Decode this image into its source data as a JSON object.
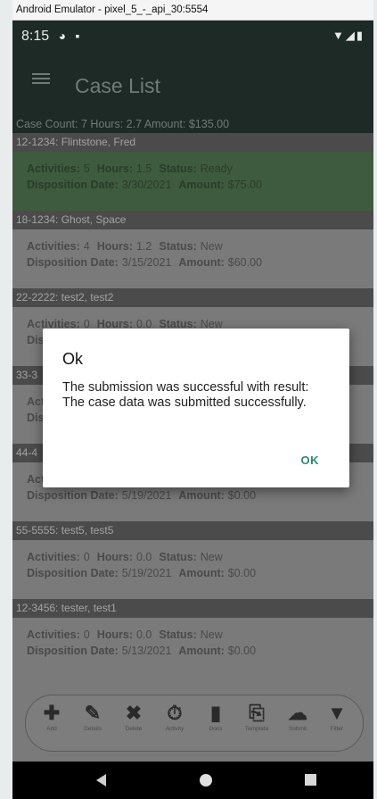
{
  "window": {
    "title": "Android Emulator - pixel_5_-_api_30:5554"
  },
  "status_bar": {
    "time": "8:15"
  },
  "app_bar": {
    "title": "Case List"
  },
  "summary": "Case Count: 7 Hours: 2.7 Amount: $135.00",
  "labels": {
    "activities": "Activities:",
    "hours": "Hours:",
    "status": "Status:",
    "disposition_date": "Disposition Date:",
    "amount": "Amount:"
  },
  "cases": [
    {
      "header": "12-1234: Flintstone, Fred",
      "activities": "5",
      "hours": "1.5",
      "status": "Ready",
      "disposition_date": "3/30/2021",
      "amount": "$75.00"
    },
    {
      "header": "18-1234: Ghost, Space",
      "activities": "4",
      "hours": "1.2",
      "status": "New",
      "disposition_date": "3/15/2021",
      "amount": "$60.00"
    },
    {
      "header": "22-2222: test2, test2",
      "activities": "0",
      "hours": "0.0",
      "status": "New",
      "disposition_date": "",
      "amount": ""
    },
    {
      "header": "33-3",
      "activities": "",
      "hours": "",
      "status": "",
      "disposition_date": "",
      "amount": ""
    },
    {
      "header": "44-4",
      "activities": "",
      "hours": "",
      "status": "",
      "disposition_date": "5/19/2021",
      "amount": "$0.00"
    },
    {
      "header": "55-5555: test5, test5",
      "activities": "0",
      "hours": "0.0",
      "status": "New",
      "disposition_date": "5/19/2021",
      "amount": "$0.00"
    },
    {
      "header": "12-3456: tester, test1",
      "activities": "0",
      "hours": "0.0",
      "status": "New",
      "disposition_date": "5/13/2021",
      "amount": "$0.00"
    }
  ],
  "bottom_nav": [
    {
      "label": "Add",
      "icon": "plus-icon",
      "glyph": "✚"
    },
    {
      "label": "Details",
      "icon": "edit-icon",
      "glyph": "✎"
    },
    {
      "label": "Delete",
      "icon": "delete-x-icon",
      "glyph": "✖"
    },
    {
      "label": "Activity",
      "icon": "stopwatch-icon",
      "glyph": "⏱"
    },
    {
      "label": "Docs",
      "icon": "document-icon",
      "glyph": "▮"
    },
    {
      "label": "Template",
      "icon": "template-icon",
      "glyph": "⎘"
    },
    {
      "label": "Submit",
      "icon": "cloud-upload-icon",
      "glyph": "☁"
    },
    {
      "label": "Filter",
      "icon": "filter-icon",
      "glyph": "▼"
    }
  ],
  "dialog": {
    "title": "Ok",
    "message": "The submission was successful with result: The case data was submitted successfully.",
    "ok_label": "OK"
  },
  "colors": {
    "accent": "#2e8b6e",
    "app_bar": "#1d2a26",
    "selected_case": "#3f5b3f"
  }
}
